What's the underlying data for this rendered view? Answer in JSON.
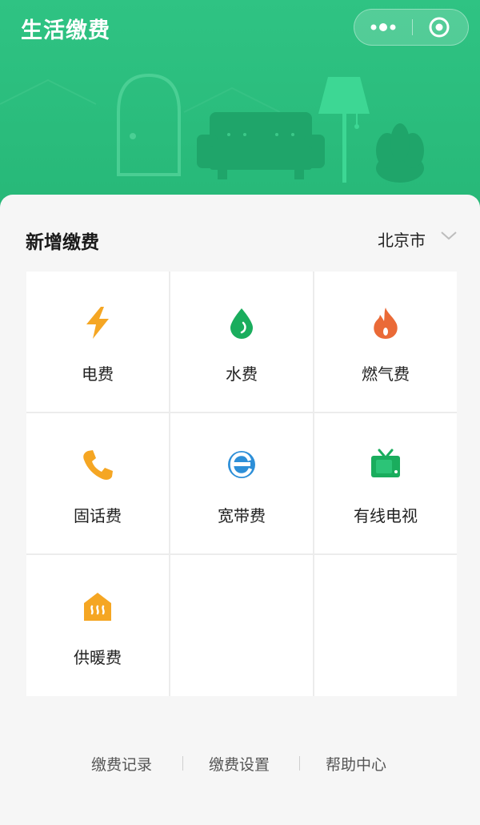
{
  "header": {
    "title": "生活缴费",
    "more_icon": "more-dots-icon",
    "close_icon": "target-close-icon",
    "accent": "#2fc383"
  },
  "section": {
    "title": "新增缴费",
    "city": "北京市"
  },
  "services": [
    {
      "label": "电费",
      "icon": "lightning-icon",
      "color": "#f5a623"
    },
    {
      "label": "水费",
      "icon": "water-drop-icon",
      "color": "#1aad5d"
    },
    {
      "label": "燃气费",
      "icon": "flame-icon",
      "color": "#ea6a37"
    },
    {
      "label": "固话费",
      "icon": "phone-icon",
      "color": "#f5a623"
    },
    {
      "label": "宽带费",
      "icon": "broadband-e-icon",
      "color": "#2d8fd8"
    },
    {
      "label": "有线电视",
      "icon": "tv-icon",
      "color": "#1aad5d"
    },
    {
      "label": "供暖费",
      "icon": "heating-house-icon",
      "color": "#f5a623"
    }
  ],
  "footer": {
    "links": [
      "缴费记录",
      "缴费设置",
      "帮助中心"
    ]
  }
}
